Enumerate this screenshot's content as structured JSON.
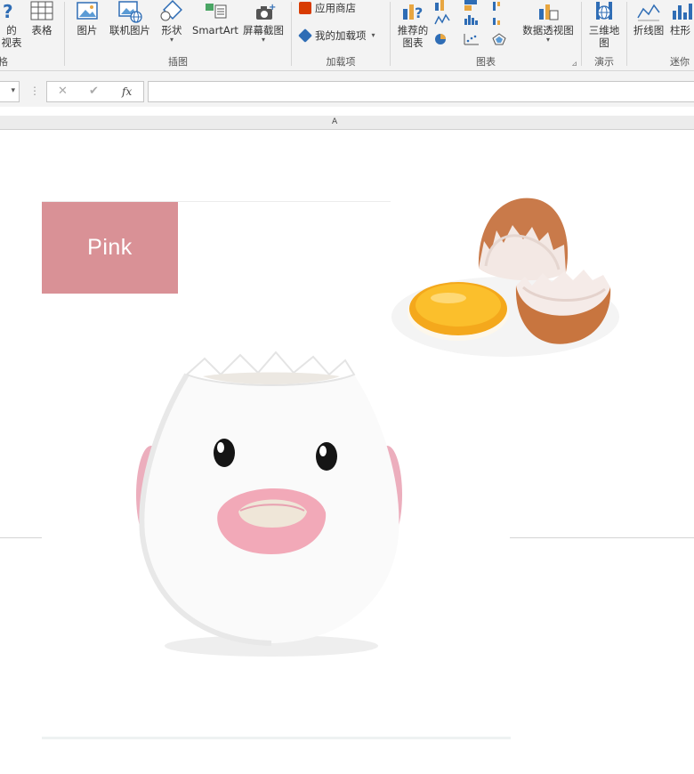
{
  "ribbon": {
    "groups": [
      {
        "label": "格"
      },
      {
        "label": "插图"
      },
      {
        "label": "加载项"
      },
      {
        "label": "图表"
      },
      {
        "label": "演示"
      },
      {
        "label": "迷你"
      }
    ],
    "buttons": {
      "pivot_partial_line1": "的",
      "pivot_partial_line2": "视表",
      "table": "表格",
      "pictures": "图片",
      "online_pictures": "联机图片",
      "shapes": "形状",
      "smartart": "SmartArt",
      "screenshot": "屏幕截图",
      "app_store": "应用商店",
      "my_addins": "我的加载项",
      "recommended_charts_line1": "推荐的",
      "recommended_charts_line2": "图表",
      "pivot_chart": "数据透视图",
      "map_line1": "三维地",
      "map_line2": "图",
      "sparkline_line": "折线图",
      "sparkline_column": "柱形"
    },
    "icons": {
      "help": "question-icon",
      "table": "table-icon",
      "pictures": "picture-icon",
      "online_pictures": "online-picture-icon",
      "shapes": "shapes-icon",
      "smartart": "smartart-icon",
      "screenshot": "camera-icon",
      "app_store": "store-icon",
      "my_addins": "addin-icon",
      "charts": "chart-icon"
    },
    "colors": {
      "accent_blue": "#2f6db5",
      "store_red": "#d83b01",
      "chart_orange": "#e8a640"
    }
  },
  "formula_bar": {
    "cancel_glyph": "✕",
    "enter_glyph": "✔",
    "function_glyph": "fx",
    "value": ""
  },
  "sheet": {
    "column_header": "A",
    "pink_label": "Pink",
    "pink_color": "#d99196"
  }
}
